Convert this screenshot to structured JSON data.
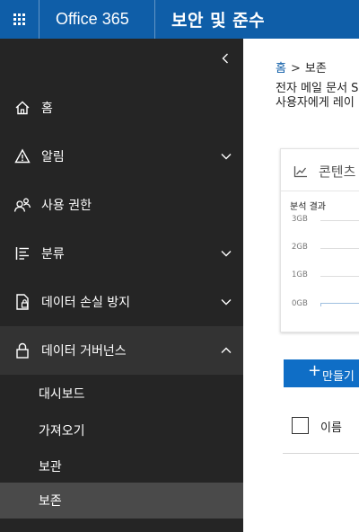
{
  "topbar": {
    "suite": "Office 365",
    "app": "보안 및 준수"
  },
  "sidebar": {
    "items": [
      {
        "label": "홈",
        "icon": "home-icon",
        "expandable": false
      },
      {
        "label": "알림",
        "icon": "alert-icon",
        "expandable": true
      },
      {
        "label": "사용 권한",
        "icon": "people-icon",
        "expandable": false
      },
      {
        "label": "분류",
        "icon": "list-icon",
        "expandable": true
      },
      {
        "label": "데이터 손실 방지",
        "icon": "dlp-icon",
        "expandable": true
      },
      {
        "label": "데이터 거버넌스",
        "icon": "lock-icon",
        "expandable": true,
        "expanded": true
      }
    ],
    "subitems": [
      {
        "label": "대시보드"
      },
      {
        "label": "가져오기"
      },
      {
        "label": "보관"
      },
      {
        "label": "보존",
        "selected": true
      }
    ]
  },
  "main": {
    "breadcrumb": {
      "home": "홈",
      "separator": ">",
      "current": "보존"
    },
    "description": [
      "전자 메일 문서 S",
      "사용자에게 레이"
    ],
    "card": {
      "title": "콘텐츠",
      "subtitle": "분석 결과",
      "ticks": [
        "3GB",
        "2GB",
        "1GB",
        "0GB"
      ]
    },
    "create_button": {
      "plus": "+",
      "label": "만들기"
    },
    "table": {
      "columns": [
        "이름"
      ]
    }
  },
  "colors": {
    "topbar": "#0f5ea8",
    "sidebar": "#252525",
    "sidebar_expanded": "#333333",
    "sidebar_selected": "#4a4a4a",
    "accent": "#0f6ec6"
  }
}
